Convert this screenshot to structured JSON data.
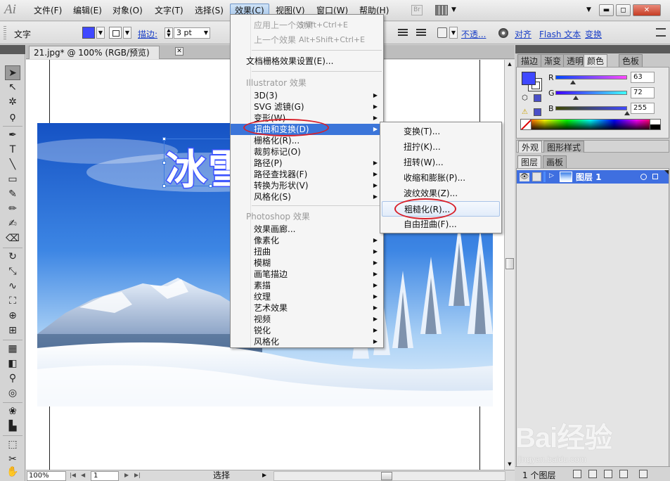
{
  "app": {
    "logo": "Ai",
    "bridge": "Br"
  },
  "menubar": {
    "items": [
      "文件(F)",
      "编辑(E)",
      "对象(O)",
      "文字(T)",
      "选择(S)",
      "效果(C)",
      "视图(V)",
      "窗口(W)",
      "帮助(H)"
    ],
    "active": "效果(C)"
  },
  "window_controls": {
    "minimize": "▬",
    "restore": "◻",
    "close": "✕"
  },
  "control_bar": {
    "type_label": "文字",
    "fill_color": "#3f48ff",
    "stroke_label": "描边:",
    "stroke_weight": "3 pt",
    "opacity_label": "不透...",
    "align_label": "对齐",
    "flash_text_label": "Flash 文本",
    "transform_label": "变换"
  },
  "document": {
    "tab_title": "21.jpg* @ 100% (RGB/预览)",
    "tab_close": "✕",
    "art_text": "冰雪"
  },
  "status_bar": {
    "zoom": "100%",
    "page": "1",
    "tool_status": "选择"
  },
  "panels": {
    "top_tabs": [
      "描边",
      "渐变",
      "透明",
      "颜色",
      "色板"
    ],
    "active_top_tab": "颜色",
    "color": {
      "channels": [
        {
          "label": "R",
          "value": "63"
        },
        {
          "label": "G",
          "value": "72"
        },
        {
          "label": "B",
          "value": "255"
        }
      ],
      "fill_hex": "#3f48ff",
      "rgb_levels": [
        0.247,
        0.282,
        1.0
      ]
    },
    "appearance_tabs": [
      "外观",
      "图形样式"
    ],
    "layers_tabs": [
      "图层",
      "画板"
    ],
    "layers": [
      {
        "name": "图层 1"
      }
    ],
    "layers_count": "1 个图层"
  },
  "effect_menu": {
    "items": [
      {
        "label": "应用上一个效果",
        "shortcut": "Shift+Ctrl+E",
        "disabled": true
      },
      {
        "label": "上一个效果",
        "shortcut": "Alt+Shift+Ctrl+E",
        "disabled": true
      },
      {
        "label": "文档栅格效果设置(E)..."
      },
      {
        "group": "Illustrator 效果"
      },
      {
        "label": "3D(3)",
        "submenu": true
      },
      {
        "label": "SVG 滤镜(G)",
        "submenu": true
      },
      {
        "label": "变形(W)",
        "submenu": true
      },
      {
        "label": "扭曲和变换(D)",
        "submenu": true,
        "highlighted": true
      },
      {
        "label": "栅格化(R)..."
      },
      {
        "label": "裁剪标记(O)"
      },
      {
        "label": "路径(P)",
        "submenu": true
      },
      {
        "label": "路径查找器(F)",
        "submenu": true
      },
      {
        "label": "转换为形状(V)",
        "submenu": true
      },
      {
        "label": "风格化(S)",
        "submenu": true
      },
      {
        "group": "Photoshop 效果"
      },
      {
        "label": "效果画廊..."
      },
      {
        "label": "像素化",
        "submenu": true
      },
      {
        "label": "扭曲",
        "submenu": true
      },
      {
        "label": "模糊",
        "submenu": true
      },
      {
        "label": "画笔描边",
        "submenu": true
      },
      {
        "label": "素描",
        "submenu": true
      },
      {
        "label": "纹理",
        "submenu": true
      },
      {
        "label": "艺术效果",
        "submenu": true
      },
      {
        "label": "视频",
        "submenu": true
      },
      {
        "label": "锐化",
        "submenu": true
      },
      {
        "label": "风格化",
        "submenu": true
      }
    ]
  },
  "distort_submenu": {
    "items": [
      {
        "label": "变换(T)..."
      },
      {
        "label": "扭拧(K)..."
      },
      {
        "label": "扭转(W)..."
      },
      {
        "label": "收缩和膨胀(P)..."
      },
      {
        "label": "波纹效果(Z)..."
      },
      {
        "label": "粗糙化(R)...",
        "hovered": true
      },
      {
        "label": "自由扭曲(F)..."
      }
    ]
  },
  "watermark": {
    "logo": "Bai经验",
    "url": "jingyan.baidu.com"
  }
}
